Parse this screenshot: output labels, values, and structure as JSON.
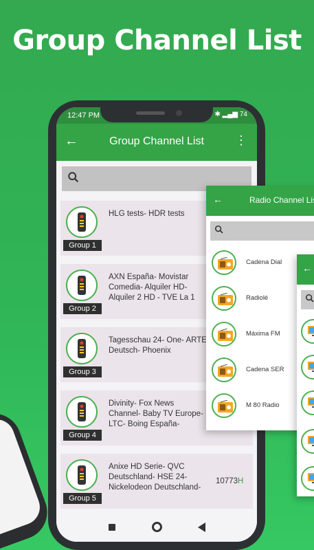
{
  "headline": "Group Channel List",
  "status": {
    "time": "12:47 PM",
    "battery": "74"
  },
  "appbar": {
    "title": "Group Channel List"
  },
  "groups": [
    {
      "label": "Group 1",
      "channels": "HLG tests- HDR tests",
      "number": ""
    },
    {
      "label": "Group 2",
      "channels": "AXN España- Movistar Comedia- Alquiler HD- Alquiler 2 HD - TVE La 1",
      "number": ""
    },
    {
      "label": "Group 3",
      "channels": "Tagesschau 24- One- ARTE Deutsch- Phoenix",
      "number": ""
    },
    {
      "label": "Group 4",
      "channels": "Divinity- Fox News Channel- Baby TV Europe- LTC- Boing España-",
      "number": ""
    },
    {
      "label": "Group 5",
      "channels": "Anixe HD Serie- QVC Deutschland- HSE 24- Nickelodeon Deutschland-",
      "number": "10773",
      "number_suffix": "H"
    }
  ],
  "radio_panel": {
    "title": "Radio Channel List",
    "items": [
      "Cadena Dial",
      "Radiolé",
      "Máxima FM",
      "Cadena SER",
      "M 80 Radio"
    ]
  },
  "colors": {
    "accent": "#34a447",
    "dark": "#2f2f2f"
  }
}
